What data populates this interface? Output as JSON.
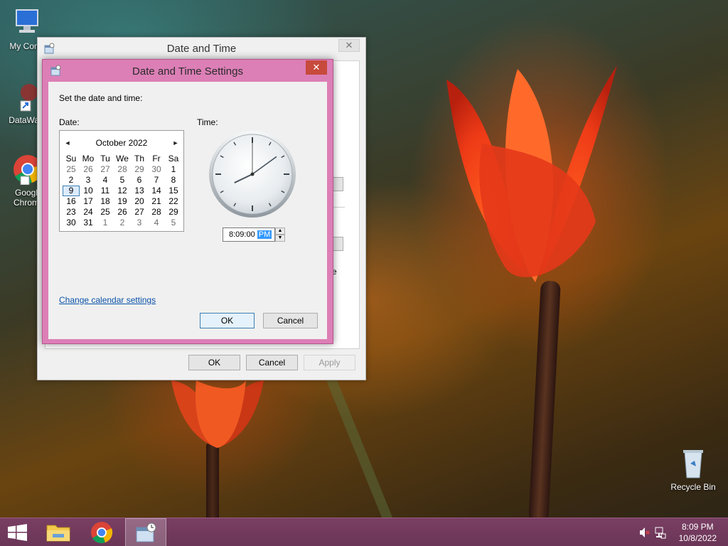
{
  "desktop": {
    "icons": [
      {
        "label": "My Comp"
      },
      {
        "label": "DataWag"
      },
      {
        "label": "Googl Chrom"
      },
      {
        "label": "Recycle Bin"
      }
    ]
  },
  "outer_window": {
    "title": "Date and Time",
    "close_glyph": "✕",
    "buttons": {
      "ok": "OK",
      "cancel": "Cancel",
      "apply": "Apply"
    },
    "sliver_text": "e"
  },
  "dialog": {
    "title": "Date and Time Settings",
    "close_glyph": "✕",
    "instruction": "Set the date and time:",
    "date_label": "Date:",
    "time_label": "Time:",
    "calendar": {
      "month_label": "October 2022",
      "prev_glyph": "◄",
      "next_glyph": "►",
      "weekdays": [
        "Su",
        "Mo",
        "Tu",
        "We",
        "Th",
        "Fr",
        "Sa"
      ],
      "weeks": [
        [
          "25",
          "26",
          "27",
          "28",
          "29",
          "30",
          "1"
        ],
        [
          "2",
          "3",
          "4",
          "5",
          "6",
          "7",
          "8"
        ],
        [
          "9",
          "10",
          "11",
          "12",
          "13",
          "14",
          "15"
        ],
        [
          "16",
          "17",
          "18",
          "19",
          "20",
          "21",
          "22"
        ],
        [
          "23",
          "24",
          "25",
          "26",
          "27",
          "28",
          "29"
        ],
        [
          "30",
          "31",
          "1",
          "2",
          "3",
          "4",
          "5"
        ]
      ],
      "selected_day": "9"
    },
    "clock": {
      "hour": 8,
      "minute": 9,
      "second": 0
    },
    "time_value": "8:09:00",
    "time_ampm": "PM",
    "spin_up": "▲",
    "spin_down": "▼",
    "calendar_link": "Change calendar settings",
    "ok": "OK",
    "cancel": "Cancel"
  },
  "taskbar": {
    "clock_time": "8:09 PM",
    "clock_date": "10/8/2022"
  },
  "colors": {
    "dialog_frame": "#dc7fb6",
    "close_red": "#c74a3c",
    "taskbar": "#6a3556",
    "link": "#0a53a8",
    "selection": "#3399ff"
  }
}
